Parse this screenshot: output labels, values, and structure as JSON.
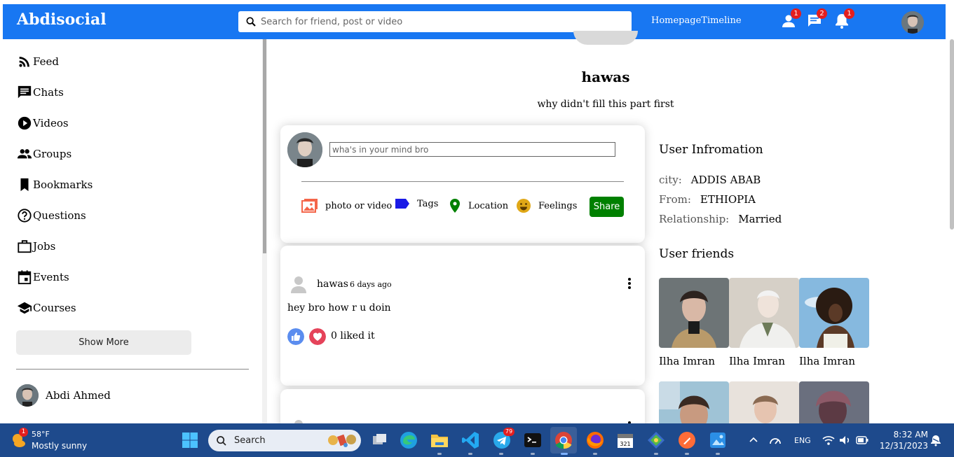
{
  "app": {
    "title": "Abdisocial"
  },
  "search": {
    "placeholder": "Search for friend, post or video"
  },
  "nav": {
    "links": [
      "Homepage",
      "Timeline"
    ],
    "badges": {
      "friends": "1",
      "messages": "2",
      "notifications": "1"
    }
  },
  "sidebar": {
    "items": [
      {
        "label": "Feed",
        "icon": "rss-icon"
      },
      {
        "label": "Chats",
        "icon": "chat-icon"
      },
      {
        "label": "Videos",
        "icon": "play-circle-icon"
      },
      {
        "label": "Groups",
        "icon": "group-icon"
      },
      {
        "label": "Bookmarks",
        "icon": "bookmark-icon"
      },
      {
        "label": "Questions",
        "icon": "help-icon"
      },
      {
        "label": "Jobs",
        "icon": "work-icon"
      },
      {
        "label": "Events",
        "icon": "calendar-icon"
      },
      {
        "label": "Courses",
        "icon": "school-icon"
      }
    ],
    "show_more": "Show More",
    "friends": [
      {
        "name": "Abdi Ahmed"
      }
    ]
  },
  "profile": {
    "name": "hawas",
    "description": "why didn't fill this part first"
  },
  "share": {
    "placeholder": "wha's in your mind bro",
    "options": [
      "photo or video",
      "Tags",
      "Location",
      "Feelings"
    ],
    "share_label": "Share"
  },
  "posts": [
    {
      "user": "hawas",
      "time": "6 days ago",
      "text": "hey bro how r u doin",
      "likes": "0 liked it"
    }
  ],
  "user_info": {
    "title": "User Infromation",
    "rows": [
      {
        "key": "city:",
        "value": "ADDIS ABAB"
      },
      {
        "key": "From:",
        "value": "ETHIOPIA"
      },
      {
        "key": "Relationship:",
        "value": "Married"
      }
    ],
    "friends_title": "User friends",
    "friends": [
      {
        "name": "Ilha Imran"
      },
      {
        "name": "Ilha Imran"
      },
      {
        "name": "Ilha Imran"
      }
    ]
  },
  "taskbar": {
    "weather_temp": "58°F",
    "weather_desc": "Mostly sunny",
    "weather_badge": "1",
    "search_label": "Search",
    "telegram_badge": "79",
    "lang": "ENG",
    "time": "8:32 AM",
    "date": "12/31/2023"
  },
  "colors": {
    "nav": "#1877f2",
    "share": "#008000",
    "taskbar": "#1e4a8c",
    "badge": "#e41e1e"
  }
}
